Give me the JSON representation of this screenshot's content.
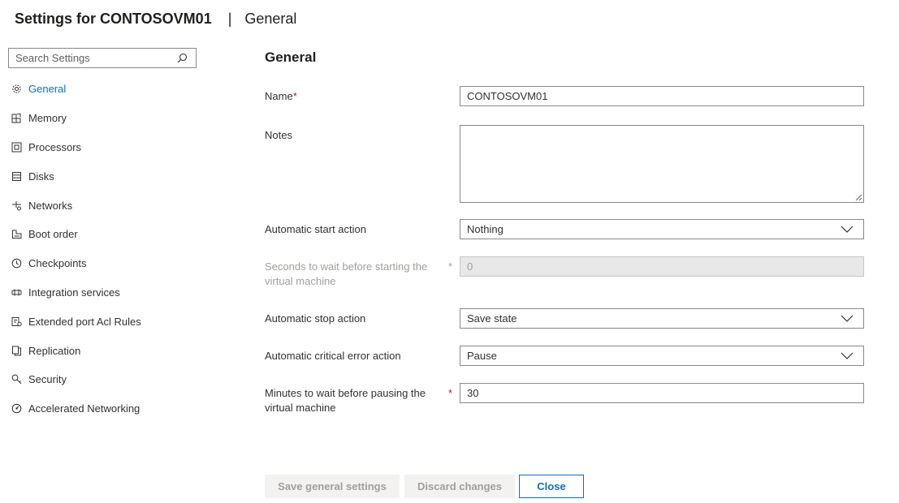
{
  "header": {
    "title": "Settings for CONTOSOVM01",
    "separator": "|",
    "section": "General"
  },
  "search": {
    "placeholder": "Search Settings",
    "icon": "search-icon"
  },
  "nav": {
    "items": [
      {
        "label": "General",
        "icon": "gear-icon",
        "active": true
      },
      {
        "label": "Memory",
        "icon": "memory-icon"
      },
      {
        "label": "Processors",
        "icon": "processor-icon"
      },
      {
        "label": "Disks",
        "icon": "disk-icon"
      },
      {
        "label": "Networks",
        "icon": "network-icon"
      },
      {
        "label": "Boot order",
        "icon": "boot-order-icon"
      },
      {
        "label": "Checkpoints",
        "icon": "clock-icon"
      },
      {
        "label": "Integration services",
        "icon": "integration-icon"
      },
      {
        "label": "Extended port Acl Rules",
        "icon": "acl-rules-icon"
      },
      {
        "label": "Replication",
        "icon": "replication-icon"
      },
      {
        "label": "Security",
        "icon": "security-icon"
      },
      {
        "label": "Accelerated Networking",
        "icon": "accelerated-networking-icon"
      }
    ]
  },
  "main": {
    "title": "General",
    "name": {
      "label": "Name",
      "required_mark": "*",
      "value": "CONTOSOVM01"
    },
    "notes": {
      "label": "Notes",
      "value": ""
    },
    "auto_start": {
      "label": "Automatic start action",
      "value": "Nothing"
    },
    "start_delay": {
      "label_line1": "Seconds to wait before starting the",
      "label_line2": "virtual machine",
      "required_mark": "*",
      "value": "0"
    },
    "auto_stop": {
      "label": "Automatic stop action",
      "value": "Save state"
    },
    "critical_error": {
      "label": "Automatic critical error action",
      "value": "Pause"
    },
    "pause_wait": {
      "label_line1": "Minutes to wait before pausing the",
      "label_line2": "virtual machine",
      "required_mark": "*",
      "value": "30"
    }
  },
  "buttons": {
    "save": "Save general settings",
    "discard": "Discard changes",
    "close": "Close"
  },
  "colors": {
    "accent": "#106ebe",
    "required": "#a4262c",
    "disabled_text": "#a19f9d",
    "disabled_bg": "#e8e8e8"
  }
}
